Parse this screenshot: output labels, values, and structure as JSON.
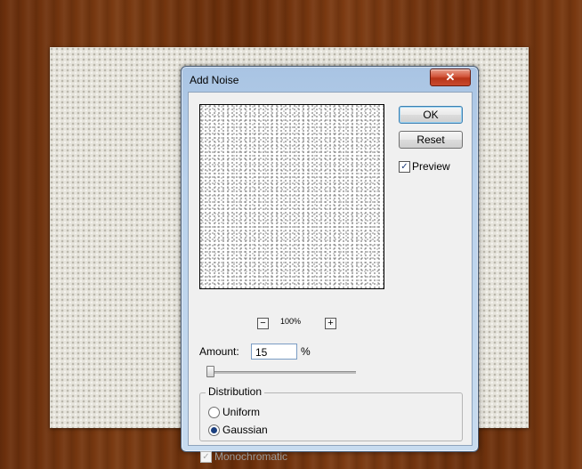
{
  "dialog": {
    "title": "Add Noise",
    "close_glyph": "✕",
    "buttons": {
      "ok": "OK",
      "reset": "Reset"
    },
    "preview": {
      "label": "Preview",
      "checked": true,
      "zoom": "100%",
      "zoom_out": "−",
      "zoom_in": "+"
    },
    "amount": {
      "label": "Amount:",
      "value": "15",
      "unit": "%",
      "slider_fraction": 0.15
    },
    "distribution": {
      "title": "Distribution",
      "options": [
        {
          "label": "Uniform",
          "selected": false
        },
        {
          "label": "Gaussian",
          "selected": true
        }
      ]
    },
    "monochromatic": {
      "label": "Monochromatic",
      "checked": true,
      "enabled": false
    }
  },
  "icons": {
    "close": "close-icon",
    "check": "checkmark-icon"
  }
}
